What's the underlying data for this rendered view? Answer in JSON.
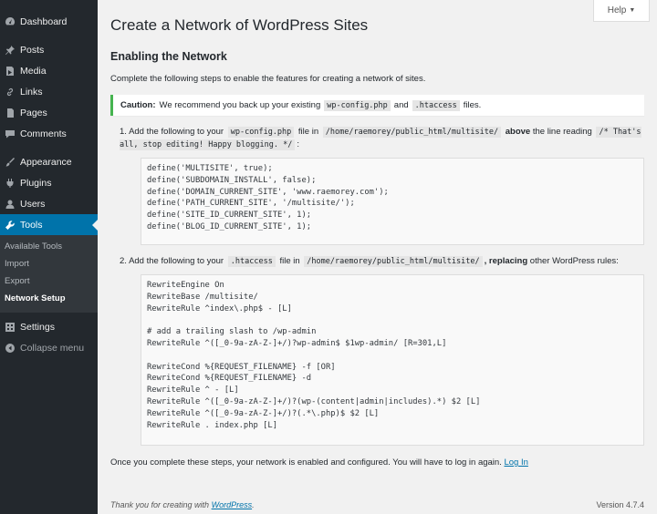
{
  "sidebar": {
    "items": [
      {
        "label": "Dashboard",
        "icon": "dashboard-icon"
      },
      {
        "label": "Posts",
        "icon": "pin-icon"
      },
      {
        "label": "Media",
        "icon": "media-icon"
      },
      {
        "label": "Links",
        "icon": "link-icon"
      },
      {
        "label": "Pages",
        "icon": "page-icon"
      },
      {
        "label": "Comments",
        "icon": "comment-icon"
      },
      {
        "label": "Appearance",
        "icon": "brush-icon"
      },
      {
        "label": "Plugins",
        "icon": "plugin-icon"
      },
      {
        "label": "Users",
        "icon": "user-icon"
      },
      {
        "label": "Tools",
        "icon": "wrench-icon"
      },
      {
        "label": "Settings",
        "icon": "settings-icon"
      }
    ],
    "tools_submenu": [
      "Available Tools",
      "Import",
      "Export",
      "Network Setup"
    ],
    "collapse_label": "Collapse menu"
  },
  "help_label": "Help",
  "page_title": "Create a Network of WordPress Sites",
  "section_title": "Enabling the Network",
  "intro": "Complete the following steps to enable the features for creating a network of sites.",
  "notice": {
    "caution": "Caution:",
    "text_before": "We recommend you back up your existing",
    "file1": "wp-config.php",
    "and": "and",
    "file2": ".htaccess",
    "text_after": "files."
  },
  "step1": {
    "num": "1.",
    "text_a": "Add the following to your",
    "file": "wp-config.php",
    "text_b": "file in",
    "path": "/home/raemorey/public_html/multisite/",
    "text_c": "above",
    "text_d": "the line reading",
    "line_code": "/* That's all, stop editing! Happy blogging. */",
    "colon": ":",
    "code": "define('MULTISITE', true);\ndefine('SUBDOMAIN_INSTALL', false);\ndefine('DOMAIN_CURRENT_SITE', 'www.raemorey.com');\ndefine('PATH_CURRENT_SITE', '/multisite/');\ndefine('SITE_ID_CURRENT_SITE', 1);\ndefine('BLOG_ID_CURRENT_SITE', 1);"
  },
  "step2": {
    "num": "2.",
    "text_a": "Add the following to your",
    "file": ".htaccess",
    "text_b": "file in",
    "path": "/home/raemorey/public_html/multisite/",
    "text_c": ", replacing",
    "text_d": "other WordPress rules:",
    "code": "RewriteEngine On\nRewriteBase /multisite/\nRewriteRule ^index\\.php$ - [L]\n\n# add a trailing slash to /wp-admin\nRewriteRule ^([_0-9a-zA-Z-]+/)?wp-admin$ $1wp-admin/ [R=301,L]\n\nRewriteCond %{REQUEST_FILENAME} -f [OR]\nRewriteCond %{REQUEST_FILENAME} -d\nRewriteRule ^ - [L]\nRewriteRule ^([_0-9a-zA-Z-]+/)?(wp-(content|admin|includes).*) $2 [L]\nRewriteRule ^([_0-9a-zA-Z-]+/)?(.*\\.php)$ $2 [L]\nRewriteRule . index.php [L]"
  },
  "outro": {
    "text": "Once you complete these steps, your network is enabled and configured. You will have to log in again.",
    "link": "Log In"
  },
  "footer": {
    "thanks": "Thank you for creating with",
    "wp_link": "WordPress",
    "period": ".",
    "version": "Version 4.7.4"
  },
  "colors": {
    "accent": "#0073aa",
    "sidebar_bg": "#23282d",
    "notice_border": "#46b450"
  }
}
